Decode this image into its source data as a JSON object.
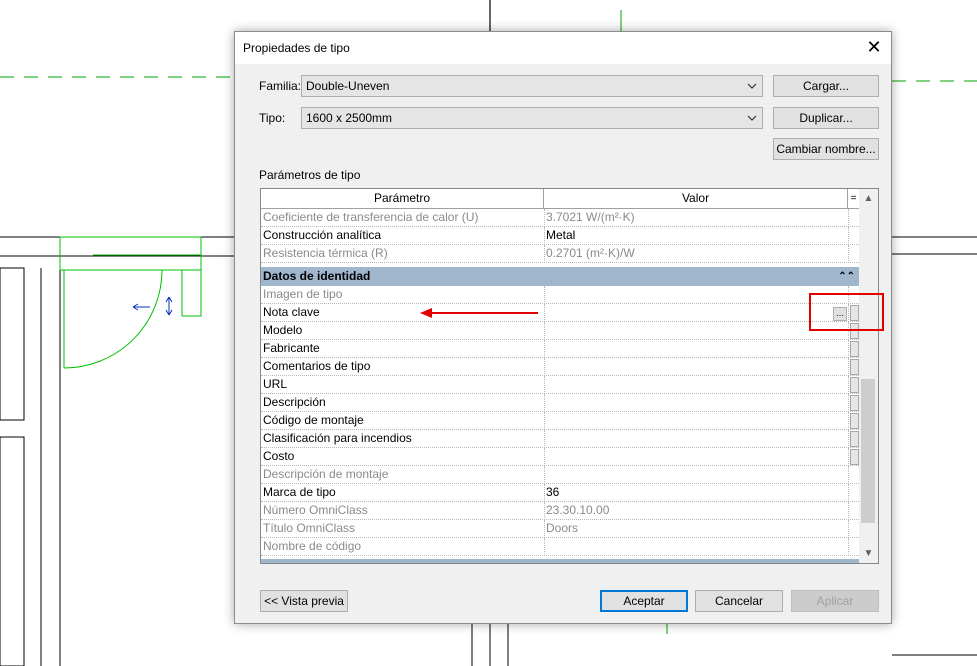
{
  "dialog": {
    "title": "Propiedades de tipo",
    "familia_label": "Familia:",
    "familia_value": "Double-Uneven",
    "tipo_label": "Tipo:",
    "tipo_value": "1600 x 2500mm",
    "buttons": {
      "cargar": "Cargar...",
      "duplicar": "Duplicar...",
      "cambiar_nombre": "Cambiar nombre..."
    },
    "params_label": "Parámetros de tipo",
    "grid": {
      "headers": {
        "param": "Parámetro",
        "value": "Valor",
        "extra": "="
      },
      "rows_top": [
        {
          "k": "Coeficiente de transferencia de calor (U)",
          "v": "3.7021 W/(m²·K)",
          "ro": true
        },
        {
          "k": "Construcción analítica",
          "v": "Metal",
          "ro": false
        },
        {
          "k": "Resistencia térmica (R)",
          "v": "0.2701 (m²·K)/W",
          "ro": true
        }
      ],
      "group": {
        "label": "Datos de identidad",
        "collapse": "⌃⌃"
      },
      "rows": [
        {
          "k": "Imagen de tipo",
          "v": "",
          "ro": true
        },
        {
          "k": "Nota clave",
          "v": "",
          "ro": false
        },
        {
          "k": "Modelo",
          "v": "",
          "ro": false
        },
        {
          "k": "Fabricante",
          "v": "",
          "ro": false
        },
        {
          "k": "Comentarios de tipo",
          "v": "",
          "ro": false
        },
        {
          "k": "URL",
          "v": "",
          "ro": false
        },
        {
          "k": "Descripción",
          "v": "",
          "ro": false
        },
        {
          "k": "Código de montaje",
          "v": "",
          "ro": false
        },
        {
          "k": "Clasificación para incendios",
          "v": "",
          "ro": false
        },
        {
          "k": "Costo",
          "v": "",
          "ro": false
        },
        {
          "k": "Descripción de montaje",
          "v": "",
          "ro": true
        },
        {
          "k": "Marca de tipo",
          "v": "36",
          "ro": false
        },
        {
          "k": "Número OmniClass",
          "v": "23.30.10.00",
          "ro": true
        },
        {
          "k": "Título OmniClass",
          "v": "Doors",
          "ro": true
        },
        {
          "k": "Nombre de código",
          "v": "",
          "ro": true
        }
      ],
      "ellipsis": "..."
    },
    "footer": {
      "preview": "<< Vista previa",
      "aceptar": "Aceptar",
      "cancelar": "Cancelar",
      "aplicar": "Aplicar"
    }
  },
  "colors": {
    "annotation_red": "#e00000",
    "cad_green": "#00b000",
    "group_band": "#9fb6cd"
  }
}
